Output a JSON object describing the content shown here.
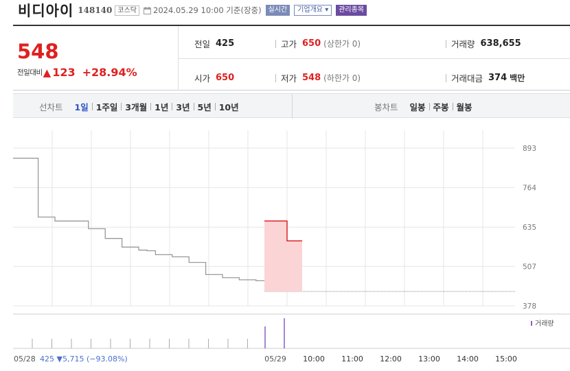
{
  "header": {
    "name": "비디아이",
    "code": "148140",
    "market": "코스닥",
    "datetime": "2024.05.29 10:00 기준(장중)",
    "badges": [
      "실시간",
      "기업개요",
      "관리종목"
    ]
  },
  "price": {
    "current": "548",
    "change_label": "전일대비",
    "change_icon": "up-triangle-icon",
    "change_value": "123",
    "change_percent": "+28.94%"
  },
  "stats": {
    "prev_close": {
      "label": "전일",
      "value": "425"
    },
    "open": {
      "label": "시가",
      "value": "650"
    },
    "high": {
      "label": "고가",
      "value": "650",
      "note": "(상한가 0)"
    },
    "low": {
      "label": "저가",
      "value": "548",
      "note": "(하한가 0)"
    },
    "volume": {
      "label": "거래량",
      "value": "638,655"
    },
    "amount": {
      "label": "거래대금",
      "value": "374",
      "unit": "백만"
    }
  },
  "line_tabs": {
    "caption": "선차트",
    "items": [
      "1일",
      "1주일",
      "3개월",
      "1년",
      "3년",
      "5년",
      "10년"
    ],
    "active": "1일"
  },
  "candle_tabs": {
    "caption": "봉차트",
    "items": [
      "일봉",
      "주봉",
      "월봉"
    ]
  },
  "colors": {
    "up": "#e02020",
    "accent": "#2f54c4",
    "price_line_prev": "#999999",
    "price_fill_today": "#fbd4d6",
    "volume_bar": "#8a5cc4"
  },
  "chart_data": {
    "type": "line",
    "title": "",
    "y_ticks": [
      "893",
      "764",
      "635",
      "507",
      "378"
    ],
    "ylim": [
      378,
      893
    ],
    "x_ticks": [
      "05/28",
      "05/29",
      "10:00",
      "11:00",
      "12:00",
      "13:00",
      "14:00",
      "15:00"
    ],
    "reference_price": 425,
    "prev_day_series": {
      "name": "05/28",
      "values": [
        860,
        860,
        860,
        668,
        668,
        655,
        655,
        655,
        655,
        630,
        630,
        598,
        598,
        570,
        570,
        560,
        558,
        545,
        545,
        538,
        538,
        520,
        520,
        480,
        480,
        470,
        470,
        463,
        463,
        460
      ]
    },
    "today_series": {
      "name": "05/29",
      "values": [
        655,
        655,
        655,
        655,
        655,
        655,
        590,
        590,
        590,
        590
      ]
    },
    "volume_legend": "거래량",
    "prev_day_footer": "425 ▼5,715 (−93.08%)",
    "grid": true
  }
}
